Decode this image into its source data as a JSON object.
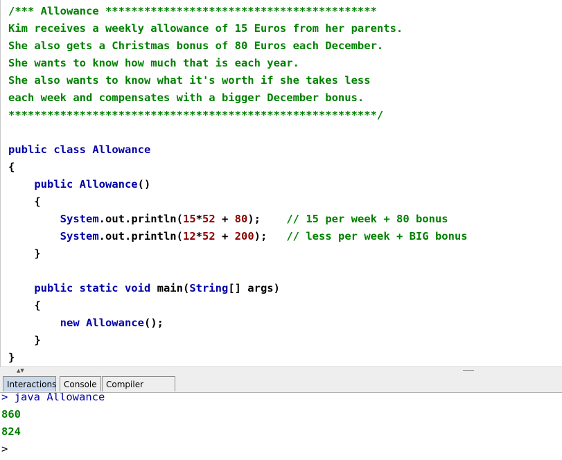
{
  "editor": {
    "lines": [
      [
        {
          "t": "/*** Allowance ******************************************",
          "c": "c"
        }
      ],
      [
        {
          "t": "Kim receives a weekly allowance of 15 Euros from her parents.",
          "c": "c"
        }
      ],
      [
        {
          "t": "She also gets a Christmas bonus of 80 Euros each December.",
          "c": "c"
        }
      ],
      [
        {
          "t": "She wants to know how much that is each year.",
          "c": "c"
        }
      ],
      [
        {
          "t": "She also wants to know what it's worth if she takes less",
          "c": "c"
        }
      ],
      [
        {
          "t": "each week and compensates with a bigger December bonus.",
          "c": "c"
        }
      ],
      [
        {
          "t": "*********************************************************/",
          "c": "c"
        }
      ],
      [],
      [
        {
          "t": "public class ",
          "c": "k"
        },
        {
          "t": "Allowance",
          "c": "k"
        }
      ],
      [
        {
          "t": "{",
          "c": "t"
        }
      ],
      [
        {
          "t": "    public ",
          "c": "k"
        },
        {
          "t": "Allowance",
          "c": "k"
        },
        {
          "t": "()",
          "c": "t"
        }
      ],
      [
        {
          "t": "    {",
          "c": "t"
        }
      ],
      [
        {
          "t": "        System",
          "c": "k"
        },
        {
          "t": ".out.println(",
          "c": "t"
        },
        {
          "t": "15",
          "c": "n"
        },
        {
          "t": "*",
          "c": "t"
        },
        {
          "t": "52",
          "c": "n"
        },
        {
          "t": " + ",
          "c": "t"
        },
        {
          "t": "80",
          "c": "n"
        },
        {
          "t": ");    ",
          "c": "t"
        },
        {
          "t": "// 15 per week + 80 bonus",
          "c": "c"
        }
      ],
      [
        {
          "t": "        System",
          "c": "k"
        },
        {
          "t": ".out.println(",
          "c": "t"
        },
        {
          "t": "12",
          "c": "n"
        },
        {
          "t": "*",
          "c": "t"
        },
        {
          "t": "52",
          "c": "n"
        },
        {
          "t": " + ",
          "c": "t"
        },
        {
          "t": "200",
          "c": "n"
        },
        {
          "t": ");   ",
          "c": "t"
        },
        {
          "t": "// less per week + BIG bonus",
          "c": "c"
        }
      ],
      [
        {
          "t": "    }",
          "c": "t"
        }
      ],
      [],
      [
        {
          "t": "    public static void ",
          "c": "k"
        },
        {
          "t": "main(",
          "c": "t"
        },
        {
          "t": "String",
          "c": "k"
        },
        {
          "t": "[] args)",
          "c": "t"
        }
      ],
      [
        {
          "t": "    {",
          "c": "t"
        }
      ],
      [
        {
          "t": "        new ",
          "c": "k"
        },
        {
          "t": "Allowance",
          "c": "k"
        },
        {
          "t": "();",
          "c": "t"
        }
      ],
      [
        {
          "t": "    }",
          "c": "t"
        }
      ],
      [
        {
          "t": "}",
          "c": "t"
        }
      ]
    ]
  },
  "tabs": [
    {
      "label": "Interactions",
      "active": true
    },
    {
      "label": "Console",
      "active": false
    },
    {
      "label": "Compiler Output",
      "active": false
    }
  ],
  "console": {
    "command": "> java Allowance",
    "outputs": [
      "860",
      "824"
    ],
    "prompt": ">"
  }
}
